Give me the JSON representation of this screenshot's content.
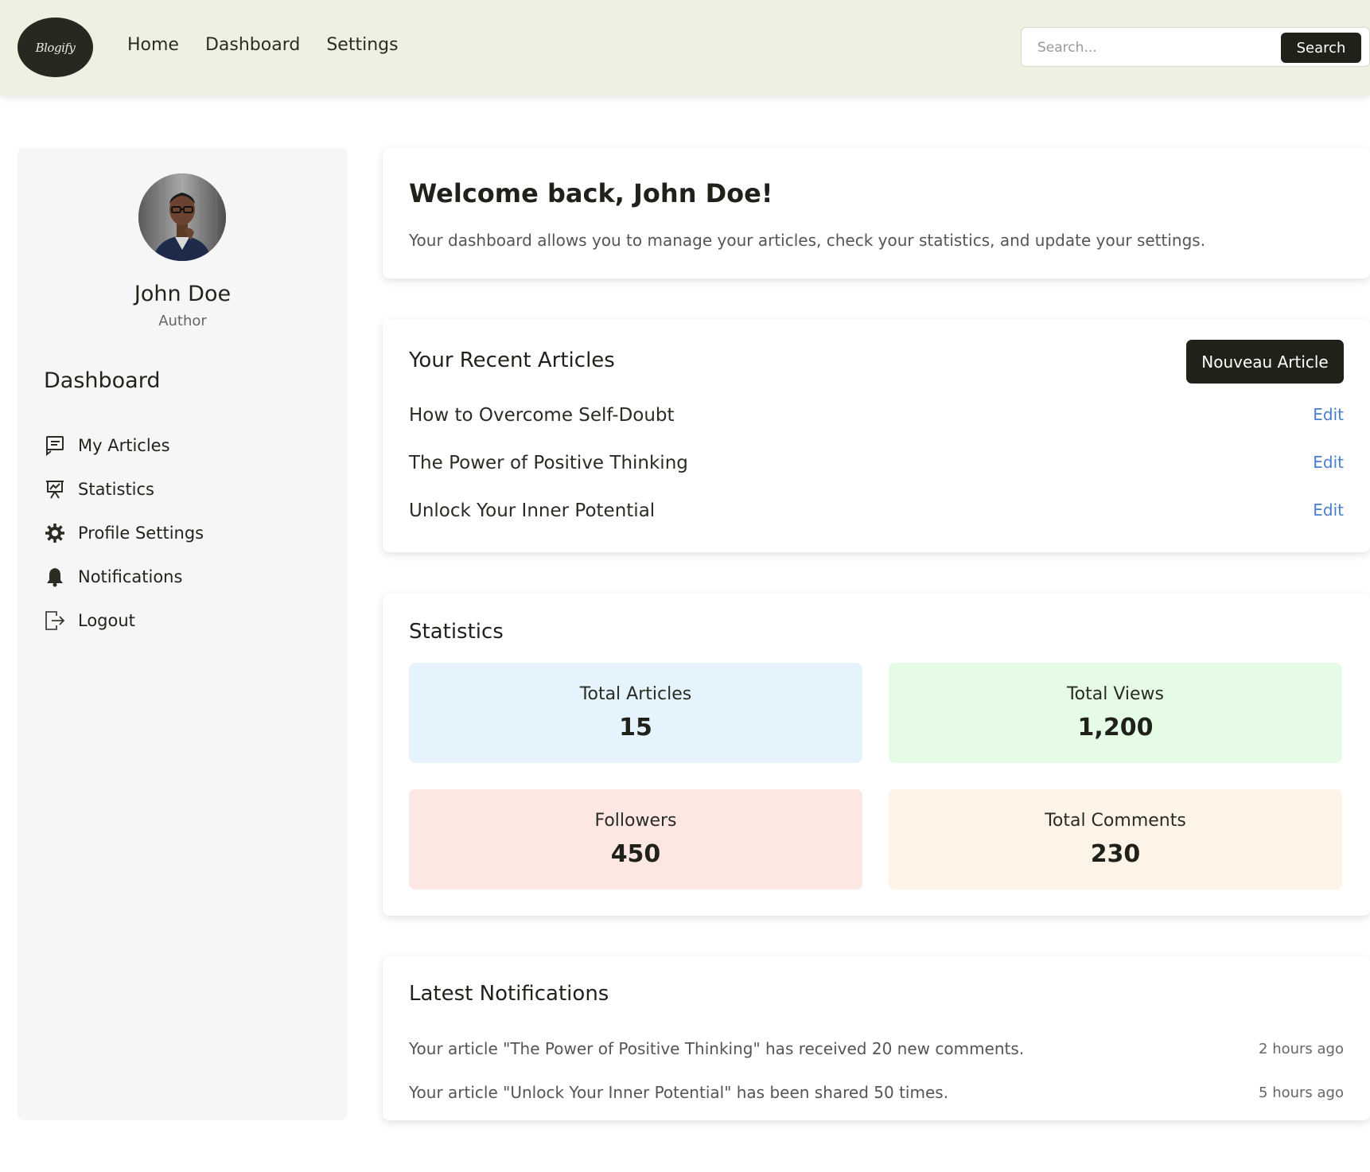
{
  "header": {
    "logo_text": "Blogify",
    "nav": [
      {
        "label": "Home"
      },
      {
        "label": "Dashboard"
      },
      {
        "label": "Settings"
      }
    ],
    "search": {
      "placeholder": "Search...",
      "value": "",
      "button_label": "Search"
    }
  },
  "sidebar": {
    "profile": {
      "name": "John Doe",
      "role": "Author"
    },
    "title": "Dashboard",
    "items": [
      {
        "label": "My Articles",
        "icon": "articles-icon"
      },
      {
        "label": "Statistics",
        "icon": "presentation-chart-icon"
      },
      {
        "label": "Profile Settings",
        "icon": "gear-icon"
      },
      {
        "label": "Notifications",
        "icon": "bell-icon"
      },
      {
        "label": "Logout",
        "icon": "logout-icon"
      }
    ]
  },
  "welcome": {
    "title": "Welcome back, John Doe!",
    "text": "Your dashboard allows you to manage your articles, check your statistics, and update your settings."
  },
  "recent_articles": {
    "title": "Your Recent Articles",
    "new_button": "Nouveau Article",
    "edit_label": "Edit",
    "items": [
      {
        "title": "How to Overcome Self-Doubt"
      },
      {
        "title": "The Power of Positive Thinking"
      },
      {
        "title": "Unlock Your Inner Potential"
      }
    ]
  },
  "statistics": {
    "title": "Statistics",
    "items": [
      {
        "label": "Total Articles",
        "value": "15",
        "color": "#e4f3fc"
      },
      {
        "label": "Total Views",
        "value": "1,200",
        "color": "#e6fbe6"
      },
      {
        "label": "Followers",
        "value": "450",
        "color": "#fce7e2"
      },
      {
        "label": "Total Comments",
        "value": "230",
        "color": "#fdf3e6"
      }
    ]
  },
  "notifications": {
    "title": "Latest Notifications",
    "items": [
      {
        "text": "Your article \"The Power of Positive Thinking\" has received 20 new comments.",
        "time": "2 hours ago"
      },
      {
        "text": "Your article \"Unlock Your Inner Potential\" has been shared 50 times.",
        "time": "5 hours ago"
      }
    ]
  },
  "colors": {
    "topbar_bg": "#eff0e2",
    "dark_button": "#202219",
    "link_blue": "#4a7fd1",
    "sidebar_bg": "#f6f6f6"
  }
}
